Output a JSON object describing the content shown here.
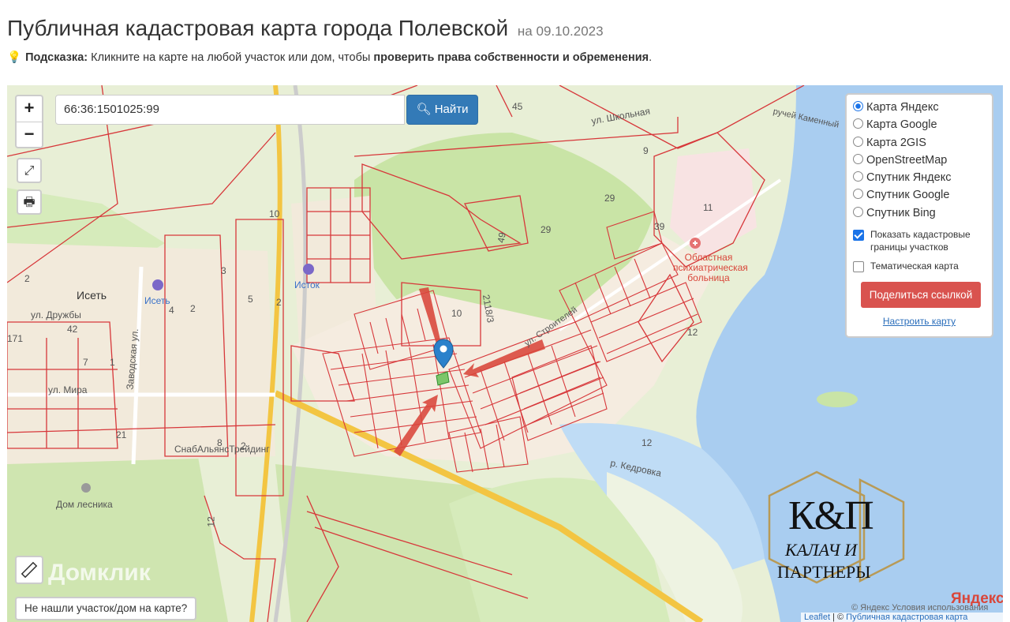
{
  "header": {
    "title": "Публичная кадастровая карта города Полевской",
    "date": "на 09.10.2023"
  },
  "hint": {
    "label": "Подсказка:",
    "text": "Кликните на карте на любой участок или дом, чтобы",
    "bold_text": "проверить права собственности и обременения",
    "end": "."
  },
  "search": {
    "value": "66:36:1501025:99",
    "button_label": "Найти"
  },
  "zoom": {
    "in": "+",
    "out": "−"
  },
  "layers": {
    "options": [
      {
        "label": "Карта Яндекс",
        "selected": true
      },
      {
        "label": "Карта Google",
        "selected": false
      },
      {
        "label": "Карта 2GIS",
        "selected": false
      },
      {
        "label": "OpenStreetMap",
        "selected": false
      },
      {
        "label": "Спутник Яндекс",
        "selected": false
      },
      {
        "label": "Спутник Google",
        "selected": false
      },
      {
        "label": "Спутник Bing",
        "selected": false
      }
    ],
    "cadastral_label": "Показать кадастровые границы участков",
    "cadastral_checked": true,
    "thematic_label": "Тематическая карта",
    "thematic_checked": false,
    "share_label": "Поделиться ссылкой",
    "setup_label": "Настроить карту"
  },
  "bottom": {
    "not_found": "Не нашли участок/дом на карте?",
    "domclick": "Домклик",
    "yandex": "Яндекс",
    "attribution_leaflet": "Leaflet",
    "attribution_separator": " | © ",
    "attribution_link": "Публичная кадастровая карта",
    "terms": "© Яндекс Условия использования"
  },
  "watermark": {
    "monogram": "К&П",
    "line1": "КАЛАЧ И",
    "line2": "ПАРТНЕРЫ"
  },
  "map_labels": {
    "isset_town": "Исеть",
    "isset_station": "Исеть",
    "istok": "Исток",
    "street_druzhby": "ул. Дружбы",
    "street_mira": "ул. Мира",
    "street_zavodskaya": "Заводская ул.",
    "street_shkolnaya": "ул. Школьная",
    "street_kamenny": "ручей Каменный",
    "river_kedrovka": "р. Кедровка",
    "forester_house": "Дом лесника",
    "snab": "СнабАльянсТрейдинг",
    "hospital": "Областная психиатрическая больница",
    "street_stroiteley": "ул. Строителей",
    "num_45": "45",
    "num_9": "9",
    "num_29a": "29",
    "num_29b": "29",
    "num_49": "49",
    "num_11": "11",
    "num_39": "39",
    "num_10a": "10",
    "num_10b": "10",
    "num_12a": "12",
    "num_12b": "12",
    "num_12c": "12",
    "num_3": "3",
    "num_5": "5",
    "num_2a": "2",
    "num_2b": "2",
    "num_4": "4",
    "num_42": "42",
    "num_71": "171",
    "num_7": "7",
    "num_1": "1",
    "num_21": "21",
    "num_8": "8",
    "num_2c": "2",
    "num_2118": "2118/3",
    "num_2d": "2"
  },
  "colors": {
    "cadastral_line": "#d7373a",
    "water": "#a9cdf0",
    "forest": "#c9e4a6",
    "built": "#f3ead8",
    "share_button": "#d9534f",
    "search_button": "#337ab7",
    "watermark_gold": "#b89a56"
  }
}
